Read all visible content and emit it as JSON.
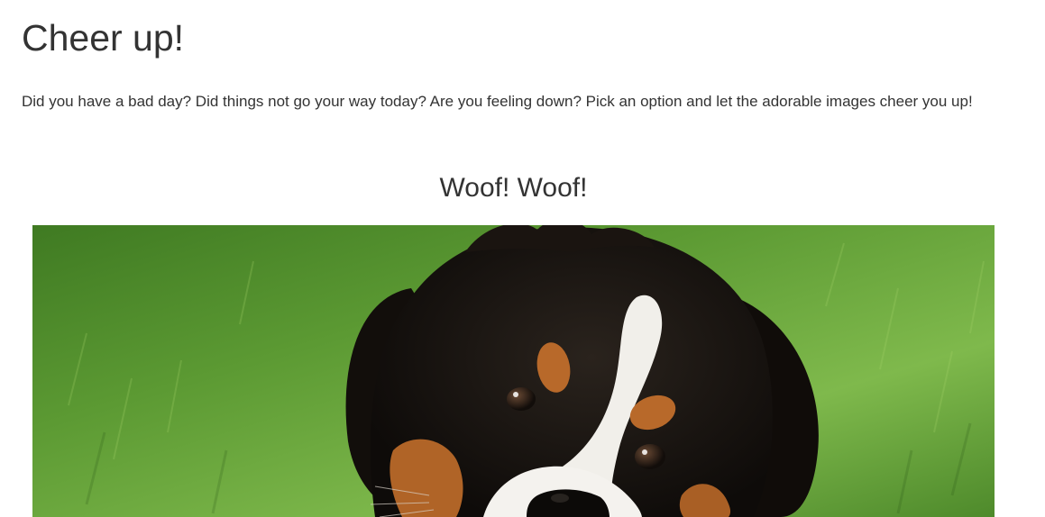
{
  "header": {
    "title": "Cheer up!"
  },
  "intro": {
    "text": "Did you have a bad day? Did things not go your way today? Are you feeling down? Pick an option and let the adorable images cheer you up!"
  },
  "section": {
    "title": "Woof! Woof!"
  },
  "image": {
    "subject": "bernese-mountain-dog-puppy",
    "colors": {
      "grass": "#4f8f2c",
      "grass_light": "#7dbb4a",
      "fur_black": "#17130f",
      "fur_tan": "#b56a2a",
      "fur_white": "#f2f0ec"
    }
  }
}
